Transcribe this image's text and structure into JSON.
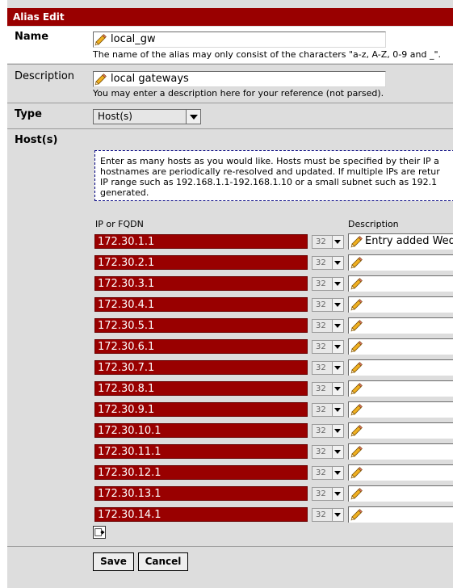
{
  "window": {
    "title": "Alias Edit"
  },
  "name_row": {
    "label": "Name",
    "value": "local_gw",
    "hint": "The name of the alias may only consist of the characters \"a-z, A-Z, 0-9 and _\"."
  },
  "description_row": {
    "label": "Description",
    "value": "local gateways",
    "hint": "You may enter a description here for your reference (not parsed)."
  },
  "type_row": {
    "label": "Type",
    "selected": "Host(s)"
  },
  "hosts": {
    "label": "Host(s)",
    "info_lines": [
      "Enter as many hosts as you would like. Hosts must be specified by their IP a",
      "hostnames are periodically re-resolved and updated. If multiple IPs are retur",
      "IP range such as 192.168.1.1-192.168.1.10 or a small subnet such as 192.1",
      "generated."
    ],
    "col_ip": "IP or FQDN",
    "col_description": "Description",
    "entries": [
      {
        "ip": "172.30.1.1",
        "mask": "32",
        "description": "Entry added Wed,"
      },
      {
        "ip": "172.30.2.1",
        "mask": "32",
        "description": ""
      },
      {
        "ip": "172.30.3.1",
        "mask": "32",
        "description": ""
      },
      {
        "ip": "172.30.4.1",
        "mask": "32",
        "description": ""
      },
      {
        "ip": "172.30.5.1",
        "mask": "32",
        "description": ""
      },
      {
        "ip": "172.30.6.1",
        "mask": "32",
        "description": ""
      },
      {
        "ip": "172.30.7.1",
        "mask": "32",
        "description": ""
      },
      {
        "ip": "172.30.8.1",
        "mask": "32",
        "description": ""
      },
      {
        "ip": "172.30.9.1",
        "mask": "32",
        "description": ""
      },
      {
        "ip": "172.30.10.1",
        "mask": "32",
        "description": ""
      },
      {
        "ip": "172.30.11.1",
        "mask": "32",
        "description": ""
      },
      {
        "ip": "172.30.12.1",
        "mask": "32",
        "description": ""
      },
      {
        "ip": "172.30.13.1",
        "mask": "32",
        "description": ""
      },
      {
        "ip": "172.30.14.1",
        "mask": "32",
        "description": ""
      }
    ]
  },
  "buttons": {
    "save": "Save",
    "cancel": "Cancel"
  },
  "colors": {
    "title_bar": "#990000",
    "ip_field": "#990000",
    "panel": "#dddddd"
  }
}
